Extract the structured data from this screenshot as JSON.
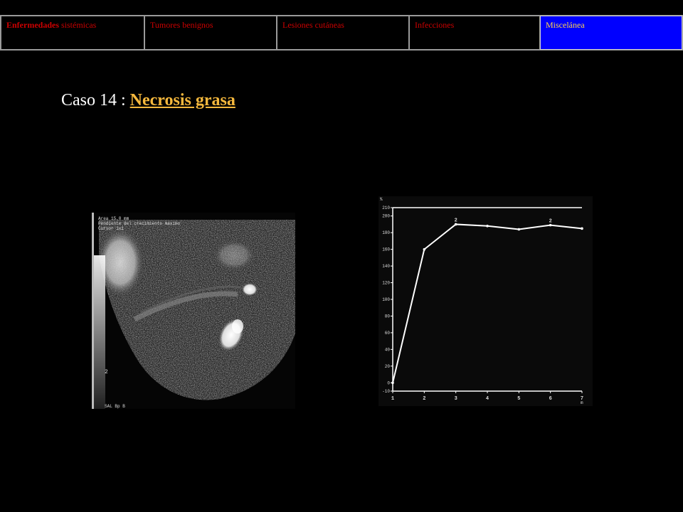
{
  "nav": {
    "tabs": [
      {
        "label_strong": "Enfermedades",
        "label": " sistémicas"
      },
      {
        "label": "Tumores benignos"
      },
      {
        "label": "Lesiones cutáneas"
      },
      {
        "label": "Infecciones"
      },
      {
        "label": "Miscelánea",
        "active": true
      }
    ]
  },
  "title": {
    "prefix": "Caso 14 : ",
    "link": "Necrosis grasa"
  },
  "mri": {
    "overlay_lines": [
      "Area 15,0 mm",
      "Pendiente del crecimiento máximo",
      "Cursor 1x1"
    ],
    "scale_label": "2",
    "footer": "SAL  Bp  B"
  },
  "chart_data": {
    "type": "line",
    "x": [
      1,
      2,
      3,
      4,
      5,
      6,
      7
    ],
    "values": [
      0,
      160,
      190,
      188,
      184,
      189,
      185
    ],
    "point_labels": [
      "",
      "",
      "2",
      "",
      "",
      "2",
      ""
    ],
    "xlim": [
      1,
      7
    ],
    "ylim": [
      -10,
      210
    ],
    "yticks": [
      -10,
      0,
      20,
      40,
      60,
      80,
      100,
      120,
      140,
      160,
      180,
      200,
      210
    ],
    "xticks": [
      "1",
      "2",
      "3",
      "4",
      "5",
      "6",
      "7"
    ],
    "y_unit": "%",
    "x_unit": "m",
    "grid": false,
    "colors": {
      "line": "#ffffff",
      "background": "#0a0a0a"
    }
  }
}
